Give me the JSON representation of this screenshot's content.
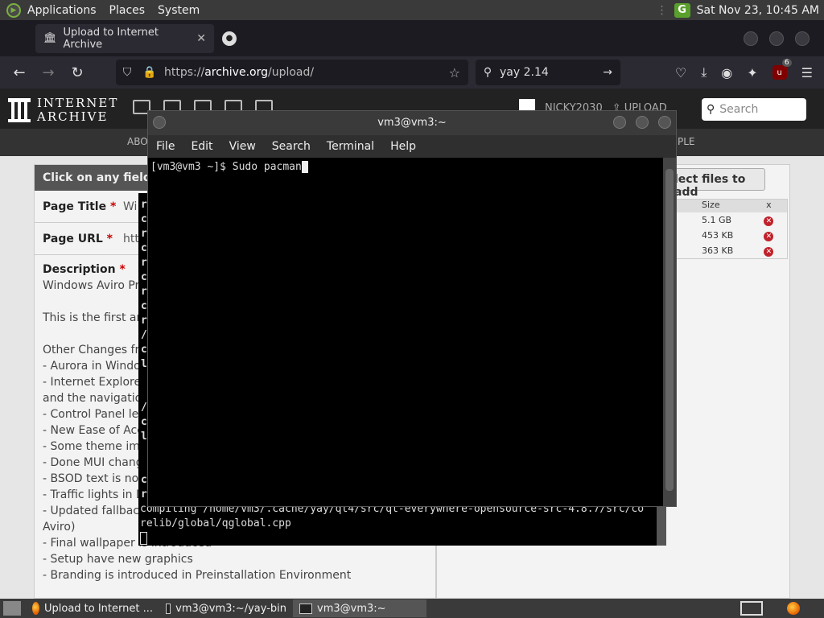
{
  "top_panel": {
    "menus": [
      "Applications",
      "Places",
      "System"
    ],
    "datetime": "Sat Nov 23, 10:45 AM"
  },
  "browser": {
    "tabs": [
      {
        "title": "Upload to Internet Archive",
        "active": true
      },
      {
        "title": "",
        "active": false
      }
    ],
    "url": {
      "prefix": "https://",
      "host": "archive.org",
      "path": "/upload/"
    },
    "search_query": "yay 2.14",
    "ublock_badge": "6"
  },
  "ia_page": {
    "logo_line1": "INTERNET",
    "logo_line2": "ARCHIVE",
    "username": "NICKY2030",
    "upload_label": "UPLOAD",
    "search_placeholder": "Search",
    "subnav_left": "ABO",
    "subnav_right": "PLE",
    "form_header": "Click on any field",
    "page_title_label": "Page Title",
    "page_title_value": "Wi",
    "page_url_label": "Page URL",
    "page_url_value": "htt",
    "required_mark": "*",
    "description_label": "Description",
    "description_lines": [
      "Windows Aviro Pre",
      "",
      "This is the first and",
      "",
      "Other Changes fro",
      "- Aurora in Window",
      "- Internet Explorer",
      "and the navigation",
      "- Control Panel left",
      "- New Ease of Acc",
      "- Some theme impr",
      "- Done MUI change",
      "- BSOD text is now",
      "- Traffic lights in Di",
      "- Updated fallback",
      "Aviro)",
      "- Final wallpaper is introduced",
      "- Setup have new graphics",
      "- Branding is introduced in Preinstallation Environment"
    ],
    "select_files_label": "lect files to add",
    "file_table": {
      "headers": [
        "Size",
        "x"
      ],
      "rows": [
        {
          "size": "5.1 GB"
        },
        {
          "size": "453 KB"
        },
        {
          "size": "363 KB"
        }
      ],
      "remove_glyph": "✕"
    }
  },
  "terminal_back": {
    "left_chars": [
      "r",
      "c",
      "r",
      "c",
      "r",
      "c",
      "r",
      "c",
      "r",
      "/",
      "c",
      "l",
      "",
      "",
      "/",
      "c",
      "l",
      "",
      "",
      "c",
      "r"
    ],
    "tail_line1": "compiling /home/vm3/.cache/yay/qt4/src/qt-everywhere-opensource-src-4.8.7/src/co",
    "tail_line2": "relib/global/qglobal.cpp"
  },
  "terminal_front": {
    "title": "vm3@vm3:~",
    "menu": [
      "File",
      "Edit",
      "View",
      "Search",
      "Terminal",
      "Help"
    ],
    "prompt": "[vm3@vm3 ~]$ Sudo pacman"
  },
  "taskbar": {
    "tasks": [
      {
        "label": "Upload to Internet ...",
        "icon": "firefox-icon"
      },
      {
        "label": "vm3@vm3:~/yay-bin",
        "icon": "terminal-icon"
      },
      {
        "label": "vm3@vm3:~",
        "icon": "terminal-icon"
      }
    ]
  }
}
